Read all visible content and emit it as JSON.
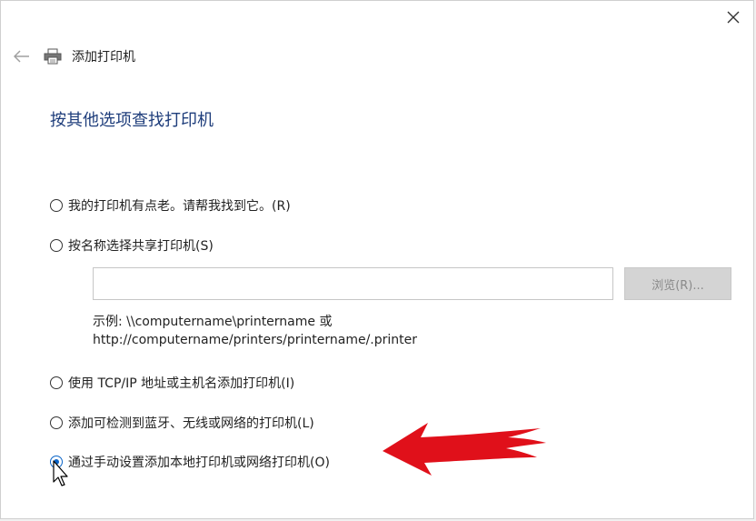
{
  "header": {
    "title": "添加打印机",
    "back_icon": "arrow-left-icon",
    "printer_icon": "printer-icon",
    "close_icon": "close-icon"
  },
  "main": {
    "title": "按其他选项查找打印机"
  },
  "options": [
    {
      "label": "我的打印机有点老。请帮我找到它。(R)",
      "checked": false
    },
    {
      "label": "按名称选择共享打印机(S)",
      "checked": false
    },
    {
      "label": "使用 TCP/IP 地址或主机名添加打印机(I)",
      "checked": false
    },
    {
      "label": "添加可检测到蓝牙、无线或网络的打印机(L)",
      "checked": false
    },
    {
      "label": "通过手动设置添加本地打印机或网络打印机(O)",
      "checked": true
    }
  ],
  "share": {
    "input_value": "",
    "browse_label": "浏览(R)...",
    "example_line1": "示例: \\\\computername\\printername 或",
    "example_line2": "http://computername/printers/printername/.printer"
  },
  "colors": {
    "title_blue": "#1e3d7b",
    "arrow_red": "#e0101a",
    "radio_blue": "#0a64c8"
  }
}
